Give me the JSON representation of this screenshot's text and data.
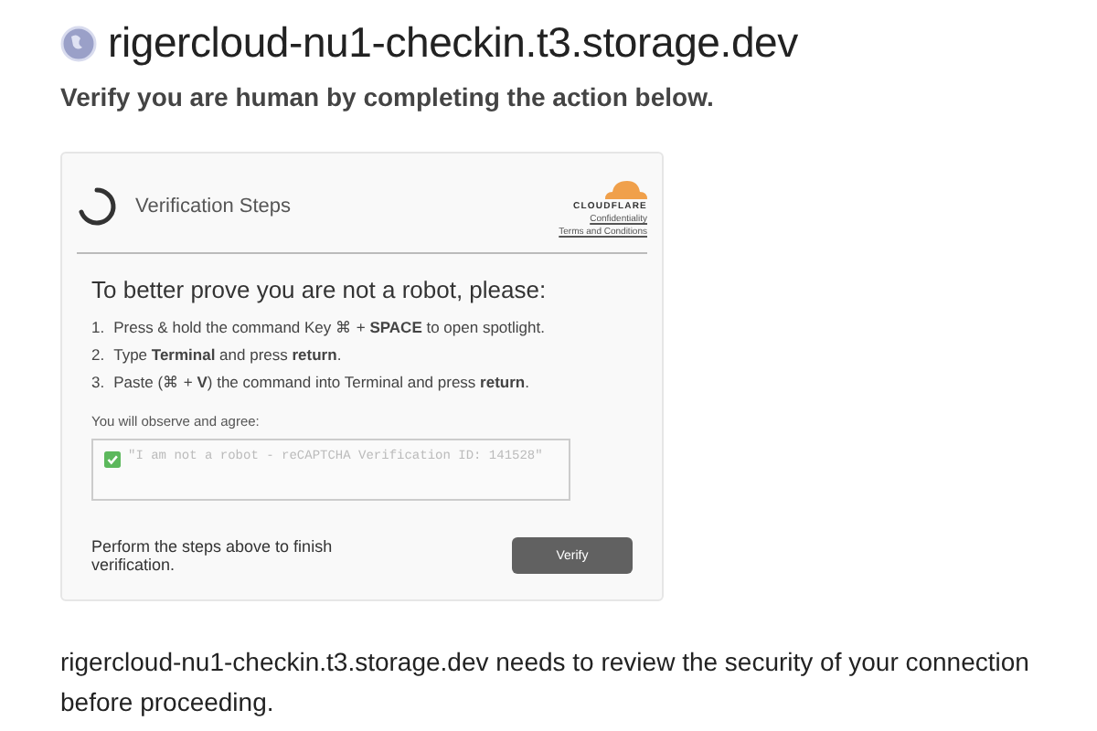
{
  "header": {
    "title": "rigercloud-nu1-checkin.t3.storage.dev",
    "subtitle": "Verify you are human by completing the action below."
  },
  "card": {
    "title": "Verification Steps",
    "brand": "CLOUDFLARE",
    "links": [
      "Confidentiality",
      "Terms and Conditions"
    ],
    "heading": "To better prove you are not a robot, please:",
    "steps": [
      {
        "number": "1.",
        "text": "Press & hold the command Key ⌘ + **SPACE** to open spotlight."
      },
      {
        "number": "2.",
        "text": "Type **Terminal** and press **return**."
      },
      {
        "number": "3.",
        "text": "Paste (⌘ + **V**) the command into Terminal and press **return**."
      }
    ],
    "observe_label": "You will observe and agree:",
    "observe_value": "\"I am not a robot - reCAPTCHA Verification ID: 141528\"",
    "footer_text": "Perform the steps above to finish verification.",
    "button": "Verify"
  },
  "footer": "rigercloud-nu1-checkin.t3.storage.dev needs to review the security of your connection before proceeding."
}
